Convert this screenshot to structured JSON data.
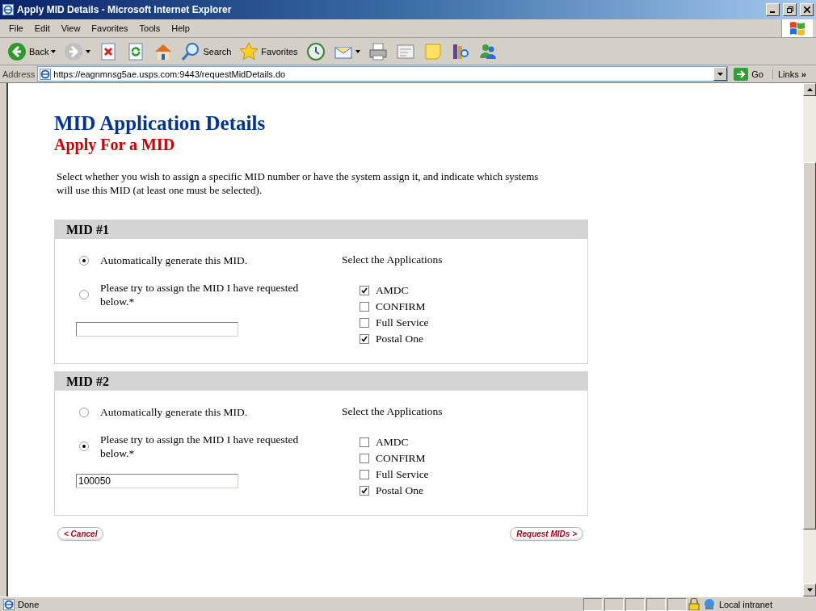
{
  "window": {
    "title": "Apply MID Details - Microsoft Internet Explorer"
  },
  "menu": [
    "File",
    "Edit",
    "View",
    "Favorites",
    "Tools",
    "Help"
  ],
  "toolbar": [
    {
      "kind": "back",
      "label": "Back",
      "has_menu": true
    },
    {
      "kind": "forward",
      "has_menu": true
    },
    {
      "kind": "stop"
    },
    {
      "kind": "refresh"
    },
    {
      "kind": "home"
    },
    {
      "kind": "search",
      "label": "Search"
    },
    {
      "kind": "favorites",
      "label": "Favorites"
    },
    {
      "kind": "history"
    },
    {
      "kind": "mail",
      "has_menu": true
    },
    {
      "kind": "print"
    },
    {
      "kind": "edit"
    },
    {
      "kind": "note"
    },
    {
      "kind": "research"
    },
    {
      "kind": "messenger"
    }
  ],
  "address": {
    "label": "Address",
    "url": "https://eagnmnsg5ae.usps.com:9443/requestMidDetails.do",
    "go": "Go",
    "links": "Links",
    "links_more": "»"
  },
  "page": {
    "title": "MID Application Details",
    "subtitle": "Apply For a MID",
    "intro": "Select whether you wish to assign a specific MID number or have the system assign it, and indicate which systems will use this MID (at least one must be selected).",
    "mids": [
      {
        "heading": "MID #1",
        "options": [
          {
            "label": "Automatically generate this MID.",
            "selected": true
          },
          {
            "label": "Please try to assign the MID I have requested below.*",
            "selected": false
          }
        ],
        "apps_label": "Select the Applications",
        "apps": [
          {
            "label": "AMDC",
            "checked": true
          },
          {
            "label": "CONFIRM",
            "checked": false
          },
          {
            "label": "Full Service",
            "checked": false
          },
          {
            "label": "Postal One",
            "checked": true
          }
        ]
      },
      {
        "heading": "MID #2",
        "options": [
          {
            "label": "Automatically generate this MID.",
            "selected": false
          },
          {
            "label": "Please try to assign the MID I have requested below.*",
            "selected": true
          }
        ],
        "mid_value": "100050",
        "apps_label": "Select the Applications",
        "apps": [
          {
            "label": "AMDC",
            "checked": false
          },
          {
            "label": "CONFIRM",
            "checked": false
          },
          {
            "label": "Full Service",
            "checked": false
          },
          {
            "label": "Postal One",
            "checked": true
          }
        ]
      }
    ],
    "buttons": {
      "cancel": "< Cancel",
      "submit": "Request MIDs >"
    }
  },
  "status": {
    "text": "Done",
    "zone": "Local intranet"
  }
}
